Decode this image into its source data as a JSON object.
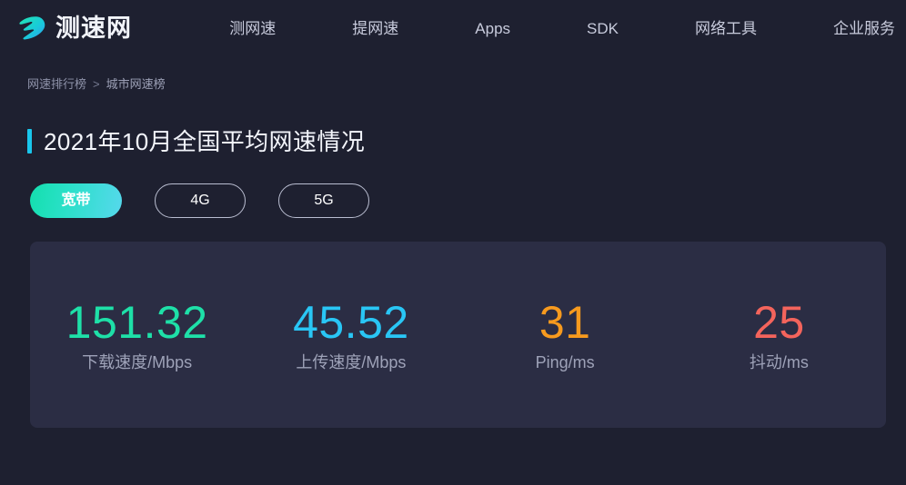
{
  "header": {
    "brand": {
      "logo_icon": "speed-s-logo-icon",
      "text": "测速网"
    },
    "nav_items": [
      {
        "label": "测网速"
      },
      {
        "label": "提网速"
      },
      {
        "label": "Apps"
      },
      {
        "label": "SDK"
      },
      {
        "label": "网络工具"
      },
      {
        "label": "企业服务"
      }
    ]
  },
  "breadcrumb": {
    "root": "网速排行榜",
    "separator": ">",
    "current": "城市网速榜"
  },
  "page": {
    "title": "2021年10月全国平均网速情况",
    "accent_color": "#19c6ec"
  },
  "filters": {
    "options": [
      {
        "label": "宽带",
        "active": true
      },
      {
        "label": "4G",
        "active": false
      },
      {
        "label": "5G",
        "active": false
      }
    ]
  },
  "stats": {
    "items": [
      {
        "value": "151.32",
        "label": "下载速度/Mbps",
        "color": "#1ee0a8"
      },
      {
        "value": "45.52",
        "label": "上传速度/Mbps",
        "color": "#29c6f5"
      },
      {
        "value": "31",
        "label": "Ping/ms",
        "color": "#f79a1e"
      },
      {
        "value": "25",
        "label": "抖动/ms",
        "color": "#f4645c"
      }
    ]
  },
  "colors": {
    "page_background": "#1e2030",
    "panel_background": "#2b2d44",
    "pill_active_gradient_start": "#14dfae",
    "pill_active_gradient_end": "#56d8ec",
    "text_primary": "#f3f5fb",
    "text_muted": "#9ea2b8"
  }
}
